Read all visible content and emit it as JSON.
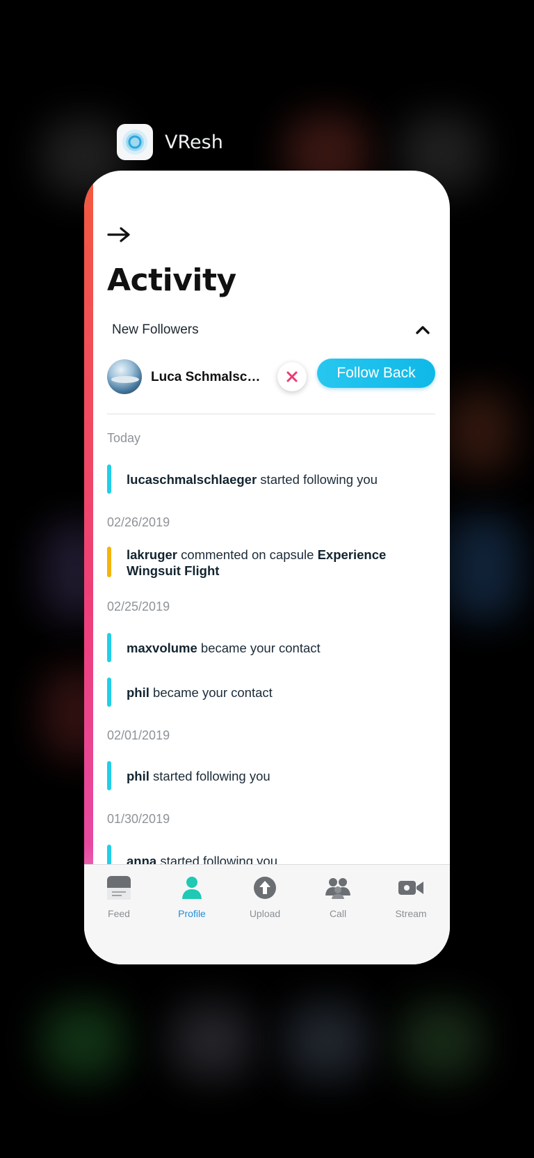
{
  "switcher": {
    "app_name": "VResh"
  },
  "page": {
    "title": "Activity"
  },
  "new_followers": {
    "section_label": "New Followers",
    "follower_name": "Luca Schmalschl...",
    "follow_back_label": "Follow Back"
  },
  "feed": [
    {
      "date": "Today"
    },
    {
      "user": "lucaschmalschlaeger",
      "text": " started following you",
      "accent": "#21cfe8"
    },
    {
      "date": "02/26/2019"
    },
    {
      "user": "lakruger",
      "text": " commented on capsule ",
      "target": "Experience Wingsuit Flight",
      "accent": "#f3b40d"
    },
    {
      "date": "02/25/2019"
    },
    {
      "user": "maxvolume",
      "text": " became your contact",
      "accent": "#21cfe8"
    },
    {
      "user": "phil",
      "text": " became your contact",
      "accent": "#21cfe8"
    },
    {
      "date": "02/01/2019"
    },
    {
      "user": "phil",
      "text": " started following you",
      "accent": "#21cfe8"
    },
    {
      "date": "01/30/2019"
    },
    {
      "user": "anna",
      "text": " started following you",
      "accent": "#21cfe8"
    }
  ],
  "tabs": [
    {
      "label": "Feed",
      "icon": "feed-icon"
    },
    {
      "label": "Profile",
      "icon": "profile-icon",
      "active": true
    },
    {
      "label": "Upload",
      "icon": "upload-icon"
    },
    {
      "label": "Call",
      "icon": "call-icon"
    },
    {
      "label": "Stream",
      "icon": "stream-icon"
    }
  ],
  "colors": {
    "accent_cyan": "#21cfe8",
    "accent_yellow": "#f3b40d",
    "tab_active": "#1e8ed8",
    "dismiss": "#ea3b73"
  }
}
